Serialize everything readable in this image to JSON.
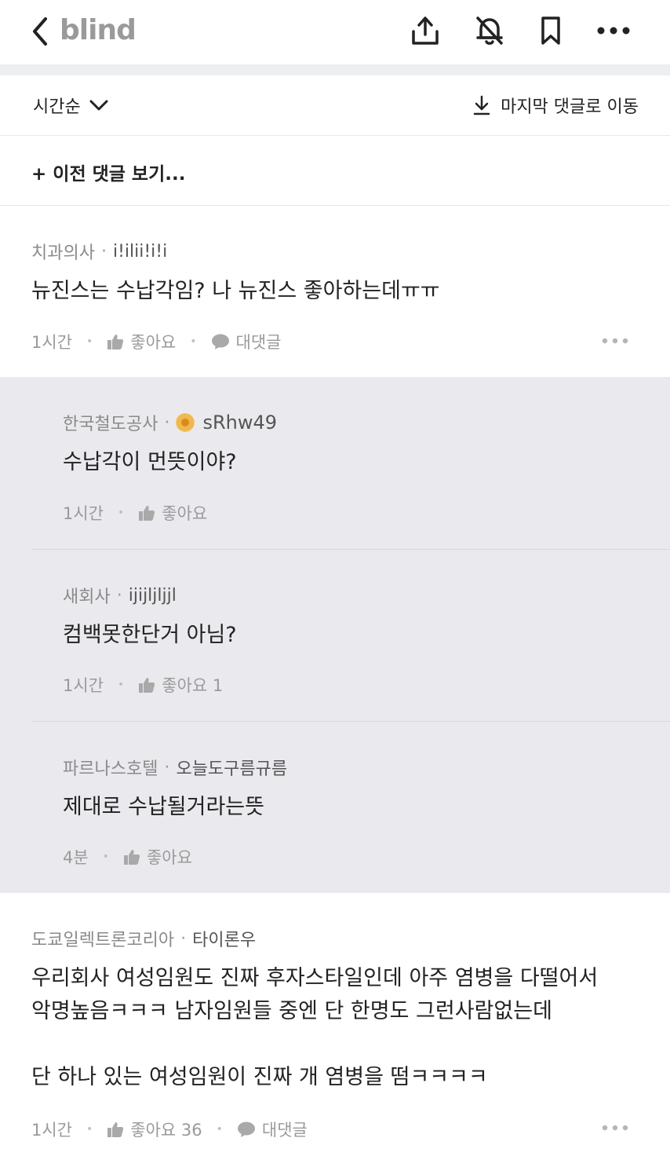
{
  "topbar": {
    "logo": "blind",
    "icons": [
      "back-icon",
      "share-icon",
      "notifications-off-icon",
      "bookmark-icon",
      "more-icon"
    ]
  },
  "sortbar": {
    "sort_label": "시간순",
    "jump_label": "마지막 댓글로 이동"
  },
  "prev_comments_label": "+ 이전 댓글 보기...",
  "comments": [
    {
      "company": "치과의사",
      "nickname": "i!ilii!i!i",
      "text": "뉴진스는 수납각임? 나 뉴진스 좋아하는데ㅠㅠ",
      "time": "1시간",
      "like_label": "좋아요",
      "reply_label": "대댓글"
    },
    {
      "company": "도쿄일렉트론코리아",
      "nickname": "타이론우",
      "text_lines": [
        "우리회사 여성임원도 진짜 후자스타일인데 아주 염병을 다떨어서",
        "악명높음ㅋㅋㅋ 남자임원들 중엔 단 한명도 그런사람없는데",
        "",
        "단 하나 있는 여성임원이 진짜 개 염병을 떰ㅋㅋㅋㅋ"
      ],
      "time": "1시간",
      "like_label": "좋아요 36",
      "reply_label": "대댓글"
    }
  ],
  "replies": [
    {
      "company": "한국철도공사",
      "nickname": "sRhw49",
      "text": "수납각이 먼뜻이야?",
      "time": "1시간",
      "like_label": "좋아요"
    },
    {
      "company": "새회사",
      "nickname": "ijijljljjl",
      "text": "컴백못한단거 아님?",
      "time": "1시간",
      "like_label": "좋아요 1"
    },
    {
      "company": "파르나스호텔",
      "nickname": "오늘도구름규름",
      "text": "제대로 수납될거라는뜻",
      "time": "4분",
      "like_label": "좋아요"
    }
  ],
  "colors": {
    "reply_background": "#eaeaee",
    "separator": "#eceef1",
    "muted_text": "#8a8a8a",
    "logo": "#9a9a9a"
  }
}
